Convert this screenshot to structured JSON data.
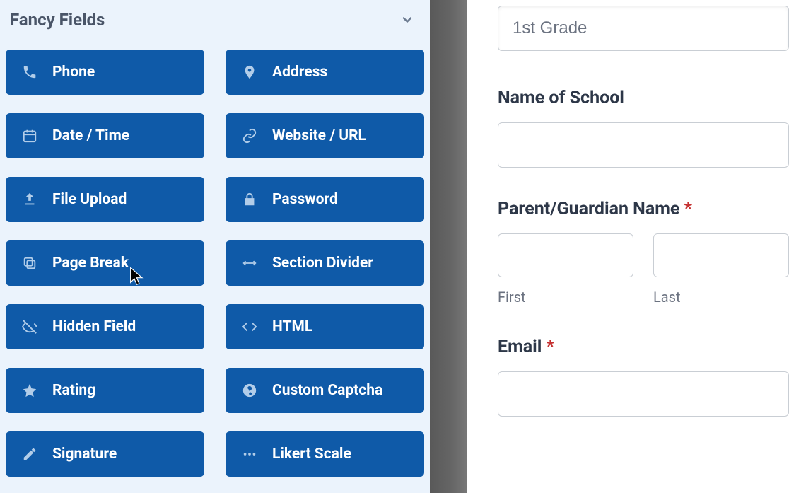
{
  "panel": {
    "title": "Fancy Fields",
    "fields": [
      {
        "label": "Phone",
        "icon": "phone-icon"
      },
      {
        "label": "Address",
        "icon": "pin-icon"
      },
      {
        "label": "Date / Time",
        "icon": "calendar-icon"
      },
      {
        "label": "Website / URL",
        "icon": "link-icon"
      },
      {
        "label": "File Upload",
        "icon": "upload-icon"
      },
      {
        "label": "Password",
        "icon": "lock-icon"
      },
      {
        "label": "Page Break",
        "icon": "copy-icon"
      },
      {
        "label": "Section Divider",
        "icon": "divider-icon"
      },
      {
        "label": "Hidden Field",
        "icon": "eye-off-icon"
      },
      {
        "label": "HTML",
        "icon": "code-icon"
      },
      {
        "label": "Rating",
        "icon": "star-icon"
      },
      {
        "label": "Custom Captcha",
        "icon": "help-icon"
      },
      {
        "label": "Signature",
        "icon": "pencil-icon"
      },
      {
        "label": "Likert Scale",
        "icon": "dots-icon"
      }
    ]
  },
  "form": {
    "grade_value": "1st Grade",
    "school_label": "Name of School",
    "parent_label": "Parent/Guardian Name",
    "first_label": "First",
    "last_label": "Last",
    "email_label": "Email",
    "required": "*"
  }
}
